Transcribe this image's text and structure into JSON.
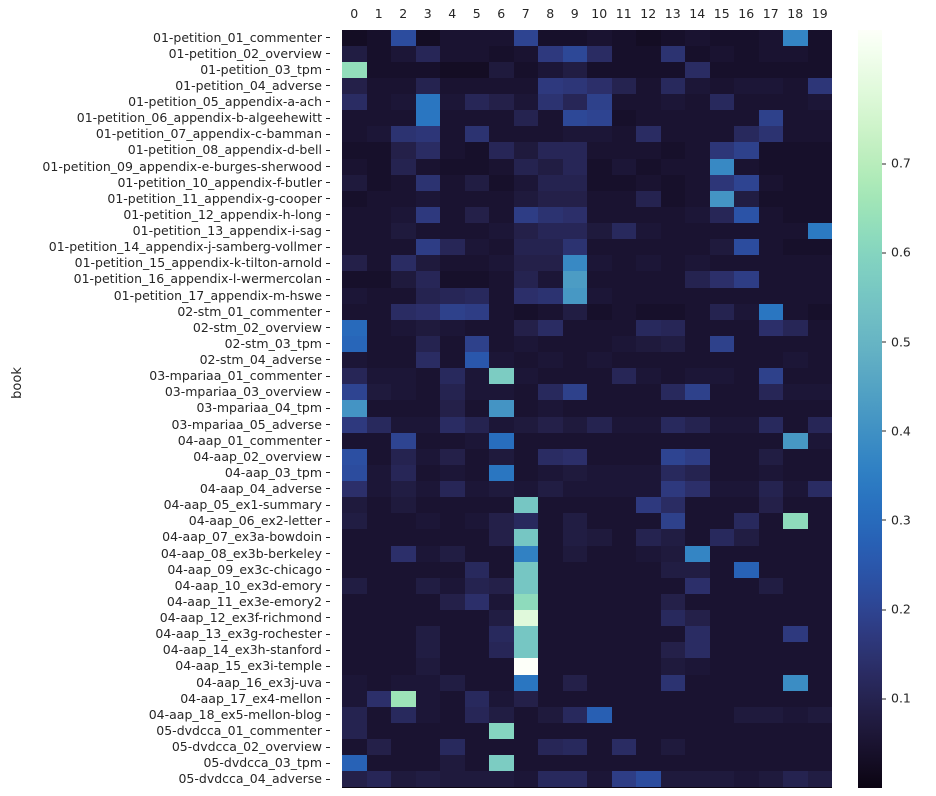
{
  "axes": {
    "ylabel": "book",
    "xticklabels": [
      "0",
      "1",
      "2",
      "3",
      "4",
      "5",
      "6",
      "7",
      "8",
      "9",
      "10",
      "11",
      "12",
      "13",
      "14",
      "15",
      "16",
      "17",
      "18",
      "19"
    ],
    "colorbar_ticklabels": [
      "0.7",
      "0.6",
      "0.5",
      "0.4",
      "0.3",
      "0.2",
      "0.1"
    ],
    "colorbar_tickvalues": [
      0.7,
      0.6,
      0.5,
      0.4,
      0.3,
      0.2,
      0.1
    ]
  },
  "chart_data": {
    "type": "heatmap",
    "title": "",
    "xlabel": "",
    "ylabel": "book",
    "grid": false,
    "legend": "colorbar-right",
    "colormap": "mako",
    "vmin": 0.0,
    "vmax": 0.85,
    "x": [
      "0",
      "1",
      "2",
      "3",
      "4",
      "5",
      "6",
      "7",
      "8",
      "9",
      "10",
      "11",
      "12",
      "13",
      "14",
      "15",
      "16",
      "17",
      "18",
      "19"
    ],
    "y": [
      "01-petition_01_commenter",
      "01-petition_02_overview",
      "01-petition_03_tpm",
      "01-petition_04_adverse",
      "01-petition_05_appendix-a-ach",
      "01-petition_06_appendix-b-algeehewitt",
      "01-petition_07_appendix-c-bamman",
      "01-petition_08_appendix-d-bell",
      "01-petition_09_appendix-e-burges-sherwood",
      "01-petition_10_appendix-f-butler",
      "01-petition_11_appendix-g-cooper",
      "01-petition_12_appendix-h-long",
      "01-petition_13_appendix-i-sag",
      "01-petition_14_appendix-j-samberg-vollmer",
      "01-petition_15_appendix-k-tilton-arnold",
      "01-petition_16_appendix-l-wermercolan",
      "01-petition_17_appendix-m-hswe",
      "02-stm_01_commenter",
      "02-stm_02_overview",
      "02-stm_03_tpm",
      "02-stm_04_adverse",
      "03-mpariaa_01_commenter",
      "03-mpariaa_03_overview",
      "03-mpariaa_04_tpm",
      "03-mpariaa_05_adverse",
      "04-aap_01_commenter",
      "04-aap_02_overview",
      "04-aap_03_tpm",
      "04-aap_04_adverse",
      "04-aap_05_ex1-summary",
      "04-aap_06_ex2-letter",
      "04-aap_07_ex3a-bowdoin",
      "04-aap_08_ex3b-berkeley",
      "04-aap_09_ex3c-chicago",
      "04-aap_10_ex3d-emory",
      "04-aap_11_ex3e-emory2",
      "04-aap_12_ex3f-richmond",
      "04-aap_13_ex3g-rochester",
      "04-aap_14_ex3h-stanford",
      "04-aap_15_ex3i-temple",
      "04-aap_16_ex3j-uva",
      "04-aap_17_ex4-mellon",
      "04-aap_18_ex5-mellon-blog",
      "05-dvdcca_01_commenter",
      "05-dvdcca_02_overview",
      "05-dvdcca_03_tpm",
      "05-dvdcca_04_adverse"
    ],
    "values": [
      [
        0.03,
        0.04,
        0.22,
        0.03,
        0.05,
        0.05,
        0.05,
        0.2,
        0.04,
        0.04,
        0.05,
        0.04,
        0.03,
        0.04,
        0.05,
        0.04,
        0.04,
        0.05,
        0.37,
        0.04
      ],
      [
        0.08,
        0.04,
        0.06,
        0.11,
        0.05,
        0.05,
        0.04,
        0.05,
        0.17,
        0.21,
        0.13,
        0.04,
        0.04,
        0.15,
        0.04,
        0.05,
        0.04,
        0.05,
        0.05,
        0.04
      ],
      [
        0.63,
        0.04,
        0.04,
        0.04,
        0.03,
        0.03,
        0.07,
        0.04,
        0.06,
        0.08,
        0.04,
        0.04,
        0.04,
        0.04,
        0.13,
        0.04,
        0.04,
        0.04,
        0.04,
        0.04
      ],
      [
        0.09,
        0.05,
        0.05,
        0.1,
        0.05,
        0.05,
        0.05,
        0.05,
        0.17,
        0.16,
        0.14,
        0.1,
        0.05,
        0.12,
        0.06,
        0.05,
        0.06,
        0.06,
        0.05,
        0.16
      ],
      [
        0.13,
        0.05,
        0.06,
        0.33,
        0.06,
        0.11,
        0.09,
        0.06,
        0.15,
        0.11,
        0.19,
        0.05,
        0.05,
        0.06,
        0.05,
        0.12,
        0.05,
        0.05,
        0.05,
        0.06
      ],
      [
        0.05,
        0.05,
        0.05,
        0.33,
        0.05,
        0.05,
        0.05,
        0.1,
        0.05,
        0.21,
        0.2,
        0.04,
        0.05,
        0.05,
        0.05,
        0.05,
        0.05,
        0.19,
        0.05,
        0.05
      ],
      [
        0.05,
        0.06,
        0.15,
        0.16,
        0.05,
        0.15,
        0.05,
        0.05,
        0.05,
        0.06,
        0.06,
        0.05,
        0.13,
        0.05,
        0.05,
        0.05,
        0.12,
        0.15,
        0.05,
        0.05
      ],
      [
        0.04,
        0.04,
        0.09,
        0.13,
        0.05,
        0.04,
        0.11,
        0.07,
        0.11,
        0.11,
        0.05,
        0.05,
        0.05,
        0.04,
        0.05,
        0.16,
        0.19,
        0.04,
        0.04,
        0.04
      ],
      [
        0.05,
        0.04,
        0.1,
        0.05,
        0.04,
        0.04,
        0.05,
        0.1,
        0.08,
        0.11,
        0.04,
        0.06,
        0.04,
        0.05,
        0.05,
        0.38,
        0.05,
        0.04,
        0.04,
        0.04
      ],
      [
        0.07,
        0.04,
        0.05,
        0.15,
        0.05,
        0.08,
        0.04,
        0.06,
        0.1,
        0.1,
        0.04,
        0.04,
        0.05,
        0.04,
        0.05,
        0.16,
        0.2,
        0.05,
        0.04,
        0.04
      ],
      [
        0.04,
        0.05,
        0.05,
        0.06,
        0.05,
        0.05,
        0.05,
        0.07,
        0.09,
        0.09,
        0.05,
        0.05,
        0.1,
        0.04,
        0.05,
        0.41,
        0.08,
        0.04,
        0.04,
        0.04
      ],
      [
        0.05,
        0.05,
        0.06,
        0.17,
        0.05,
        0.09,
        0.05,
        0.18,
        0.15,
        0.14,
        0.05,
        0.05,
        0.05,
        0.05,
        0.06,
        0.11,
        0.24,
        0.05,
        0.04,
        0.04
      ],
      [
        0.05,
        0.05,
        0.07,
        0.05,
        0.05,
        0.05,
        0.06,
        0.09,
        0.11,
        0.11,
        0.07,
        0.12,
        0.06,
        0.05,
        0.05,
        0.05,
        0.05,
        0.05,
        0.05,
        0.34
      ],
      [
        0.05,
        0.05,
        0.05,
        0.18,
        0.11,
        0.06,
        0.05,
        0.1,
        0.1,
        0.15,
        0.05,
        0.05,
        0.05,
        0.05,
        0.05,
        0.07,
        0.22,
        0.05,
        0.04,
        0.04
      ],
      [
        0.09,
        0.05,
        0.13,
        0.07,
        0.05,
        0.05,
        0.06,
        0.09,
        0.09,
        0.38,
        0.06,
        0.05,
        0.06,
        0.05,
        0.06,
        0.05,
        0.05,
        0.05,
        0.05,
        0.05
      ],
      [
        0.04,
        0.04,
        0.07,
        0.11,
        0.04,
        0.04,
        0.05,
        0.1,
        0.06,
        0.43,
        0.05,
        0.05,
        0.05,
        0.05,
        0.1,
        0.14,
        0.18,
        0.05,
        0.05,
        0.05
      ],
      [
        0.06,
        0.05,
        0.05,
        0.1,
        0.11,
        0.12,
        0.05,
        0.14,
        0.15,
        0.42,
        0.06,
        0.05,
        0.05,
        0.05,
        0.05,
        0.05,
        0.05,
        0.05,
        0.05,
        0.05
      ],
      [
        0.05,
        0.05,
        0.13,
        0.14,
        0.19,
        0.18,
        0.05,
        0.04,
        0.05,
        0.08,
        0.04,
        0.05,
        0.04,
        0.04,
        0.05,
        0.1,
        0.06,
        0.33,
        0.05,
        0.04
      ],
      [
        0.3,
        0.05,
        0.06,
        0.07,
        0.06,
        0.05,
        0.05,
        0.09,
        0.13,
        0.05,
        0.05,
        0.05,
        0.12,
        0.11,
        0.05,
        0.05,
        0.05,
        0.14,
        0.11,
        0.05
      ],
      [
        0.29,
        0.05,
        0.05,
        0.1,
        0.05,
        0.19,
        0.05,
        0.06,
        0.05,
        0.05,
        0.05,
        0.06,
        0.07,
        0.08,
        0.05,
        0.19,
        0.05,
        0.05,
        0.05,
        0.05
      ],
      [
        0.06,
        0.05,
        0.05,
        0.13,
        0.05,
        0.25,
        0.06,
        0.05,
        0.06,
        0.05,
        0.06,
        0.05,
        0.05,
        0.05,
        0.05,
        0.05,
        0.05,
        0.05,
        0.06,
        0.05
      ],
      [
        0.11,
        0.06,
        0.06,
        0.05,
        0.12,
        0.06,
        0.57,
        0.06,
        0.05,
        0.05,
        0.05,
        0.11,
        0.06,
        0.05,
        0.06,
        0.06,
        0.05,
        0.19,
        0.05,
        0.05
      ],
      [
        0.2,
        0.07,
        0.06,
        0.05,
        0.1,
        0.06,
        0.06,
        0.05,
        0.12,
        0.19,
        0.05,
        0.05,
        0.05,
        0.12,
        0.19,
        0.05,
        0.05,
        0.11,
        0.06,
        0.06
      ],
      [
        0.41,
        0.05,
        0.05,
        0.05,
        0.09,
        0.05,
        0.41,
        0.05,
        0.06,
        0.05,
        0.05,
        0.05,
        0.05,
        0.05,
        0.05,
        0.05,
        0.05,
        0.05,
        0.05,
        0.05
      ],
      [
        0.17,
        0.12,
        0.06,
        0.06,
        0.13,
        0.1,
        0.06,
        0.07,
        0.09,
        0.07,
        0.1,
        0.06,
        0.06,
        0.12,
        0.1,
        0.06,
        0.06,
        0.12,
        0.05,
        0.11
      ],
      [
        0.05,
        0.05,
        0.2,
        0.05,
        0.05,
        0.06,
        0.31,
        0.05,
        0.05,
        0.05,
        0.05,
        0.05,
        0.05,
        0.05,
        0.05,
        0.05,
        0.05,
        0.05,
        0.42,
        0.06
      ],
      [
        0.23,
        0.05,
        0.1,
        0.06,
        0.09,
        0.05,
        0.07,
        0.05,
        0.13,
        0.14,
        0.05,
        0.05,
        0.05,
        0.2,
        0.18,
        0.05,
        0.05,
        0.08,
        0.05,
        0.05
      ],
      [
        0.22,
        0.06,
        0.11,
        0.05,
        0.06,
        0.05,
        0.33,
        0.05,
        0.06,
        0.07,
        0.06,
        0.06,
        0.06,
        0.12,
        0.1,
        0.05,
        0.05,
        0.06,
        0.05,
        0.05
      ],
      [
        0.14,
        0.06,
        0.08,
        0.06,
        0.11,
        0.06,
        0.07,
        0.06,
        0.08,
        0.06,
        0.06,
        0.06,
        0.06,
        0.17,
        0.14,
        0.06,
        0.06,
        0.1,
        0.06,
        0.13
      ],
      [
        0.07,
        0.05,
        0.07,
        0.05,
        0.05,
        0.05,
        0.05,
        0.55,
        0.05,
        0.05,
        0.05,
        0.05,
        0.17,
        0.13,
        0.05,
        0.05,
        0.05,
        0.09,
        0.05,
        0.05
      ],
      [
        0.08,
        0.05,
        0.05,
        0.06,
        0.05,
        0.06,
        0.09,
        0.12,
        0.05,
        0.08,
        0.05,
        0.05,
        0.05,
        0.19,
        0.05,
        0.05,
        0.12,
        0.05,
        0.62,
        0.05
      ],
      [
        0.05,
        0.05,
        0.05,
        0.05,
        0.05,
        0.05,
        0.09,
        0.55,
        0.05,
        0.08,
        0.07,
        0.05,
        0.1,
        0.08,
        0.05,
        0.12,
        0.08,
        0.05,
        0.05,
        0.05
      ],
      [
        0.05,
        0.05,
        0.14,
        0.06,
        0.08,
        0.05,
        0.05,
        0.36,
        0.05,
        0.07,
        0.05,
        0.05,
        0.06,
        0.07,
        0.37,
        0.05,
        0.05,
        0.05,
        0.05,
        0.05
      ],
      [
        0.05,
        0.05,
        0.05,
        0.05,
        0.05,
        0.12,
        0.05,
        0.55,
        0.05,
        0.05,
        0.05,
        0.05,
        0.05,
        0.08,
        0.08,
        0.05,
        0.28,
        0.05,
        0.05,
        0.05
      ],
      [
        0.08,
        0.05,
        0.05,
        0.08,
        0.06,
        0.1,
        0.09,
        0.55,
        0.05,
        0.05,
        0.05,
        0.05,
        0.05,
        0.05,
        0.14,
        0.05,
        0.05,
        0.08,
        0.05,
        0.05
      ],
      [
        0.05,
        0.05,
        0.05,
        0.05,
        0.09,
        0.14,
        0.06,
        0.62,
        0.05,
        0.05,
        0.05,
        0.05,
        0.05,
        0.09,
        0.05,
        0.05,
        0.05,
        0.05,
        0.05,
        0.05
      ],
      [
        0.05,
        0.05,
        0.05,
        0.05,
        0.05,
        0.05,
        0.08,
        0.78,
        0.05,
        0.05,
        0.05,
        0.05,
        0.05,
        0.12,
        0.09,
        0.05,
        0.05,
        0.05,
        0.05,
        0.05
      ],
      [
        0.05,
        0.05,
        0.05,
        0.08,
        0.05,
        0.05,
        0.12,
        0.55,
        0.05,
        0.05,
        0.05,
        0.05,
        0.05,
        0.05,
        0.13,
        0.05,
        0.05,
        0.05,
        0.17,
        0.05
      ],
      [
        0.05,
        0.05,
        0.05,
        0.08,
        0.05,
        0.05,
        0.11,
        0.55,
        0.05,
        0.05,
        0.05,
        0.05,
        0.05,
        0.09,
        0.13,
        0.05,
        0.05,
        0.05,
        0.05,
        0.05
      ],
      [
        0.05,
        0.05,
        0.05,
        0.07,
        0.05,
        0.05,
        0.05,
        0.85,
        0.05,
        0.05,
        0.05,
        0.05,
        0.05,
        0.07,
        0.06,
        0.05,
        0.05,
        0.05,
        0.05,
        0.05
      ],
      [
        0.06,
        0.05,
        0.06,
        0.06,
        0.08,
        0.05,
        0.05,
        0.33,
        0.05,
        0.09,
        0.05,
        0.05,
        0.05,
        0.15,
        0.05,
        0.05,
        0.05,
        0.05,
        0.39,
        0.05
      ],
      [
        0.06,
        0.14,
        0.65,
        0.06,
        0.05,
        0.12,
        0.06,
        0.09,
        0.05,
        0.05,
        0.05,
        0.05,
        0.05,
        0.05,
        0.05,
        0.05,
        0.05,
        0.05,
        0.05,
        0.05
      ],
      [
        0.1,
        0.05,
        0.12,
        0.06,
        0.05,
        0.11,
        0.08,
        0.05,
        0.07,
        0.12,
        0.27,
        0.05,
        0.05,
        0.05,
        0.05,
        0.05,
        0.07,
        0.07,
        0.06,
        0.07
      ],
      [
        0.1,
        0.05,
        0.05,
        0.05,
        0.05,
        0.05,
        0.6,
        0.05,
        0.05,
        0.05,
        0.05,
        0.05,
        0.05,
        0.05,
        0.05,
        0.05,
        0.05,
        0.05,
        0.05,
        0.05
      ],
      [
        0.05,
        0.09,
        0.05,
        0.05,
        0.12,
        0.05,
        0.05,
        0.05,
        0.11,
        0.12,
        0.05,
        0.13,
        0.05,
        0.07,
        0.05,
        0.05,
        0.05,
        0.05,
        0.05,
        0.05
      ],
      [
        0.28,
        0.05,
        0.05,
        0.05,
        0.07,
        0.05,
        0.57,
        0.05,
        0.05,
        0.05,
        0.05,
        0.05,
        0.05,
        0.05,
        0.05,
        0.05,
        0.05,
        0.05,
        0.05,
        0.05
      ],
      [
        0.09,
        0.11,
        0.07,
        0.08,
        0.07,
        0.07,
        0.07,
        0.06,
        0.12,
        0.12,
        0.06,
        0.18,
        0.22,
        0.07,
        0.07,
        0.07,
        0.06,
        0.07,
        0.1,
        0.08
      ]
    ]
  }
}
